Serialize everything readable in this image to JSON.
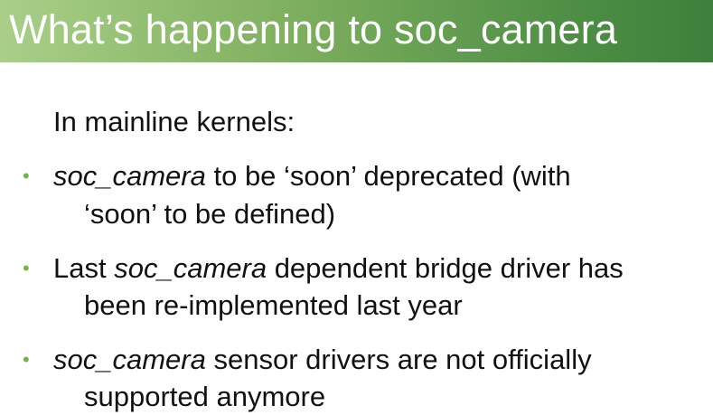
{
  "slide": {
    "title": "What’s happening to soc_camera",
    "intro": "In mainline kernels:",
    "bullets": [
      {
        "emph": "soc_camera",
        "rest": " to be ‘soon’ deprecated (with",
        "cont": "‘soon’ to be defined)"
      },
      {
        "pre": "Last ",
        "emph": "soc_camera",
        "rest": " dependent bridge driver has",
        "cont": "been re-implemented last year"
      },
      {
        "emph": "soc_camera",
        "rest": " sensor drivers are not officially",
        "cont": "supported anymore"
      }
    ]
  },
  "colors": {
    "title_gradient_start": "#a9cf88",
    "title_gradient_end": "#3e7f3b",
    "title_text": "#ffffff",
    "bullet": "#78b24a",
    "body_text": "#111111"
  },
  "icons": {
    "bullet": "bullet-dot-icon"
  }
}
